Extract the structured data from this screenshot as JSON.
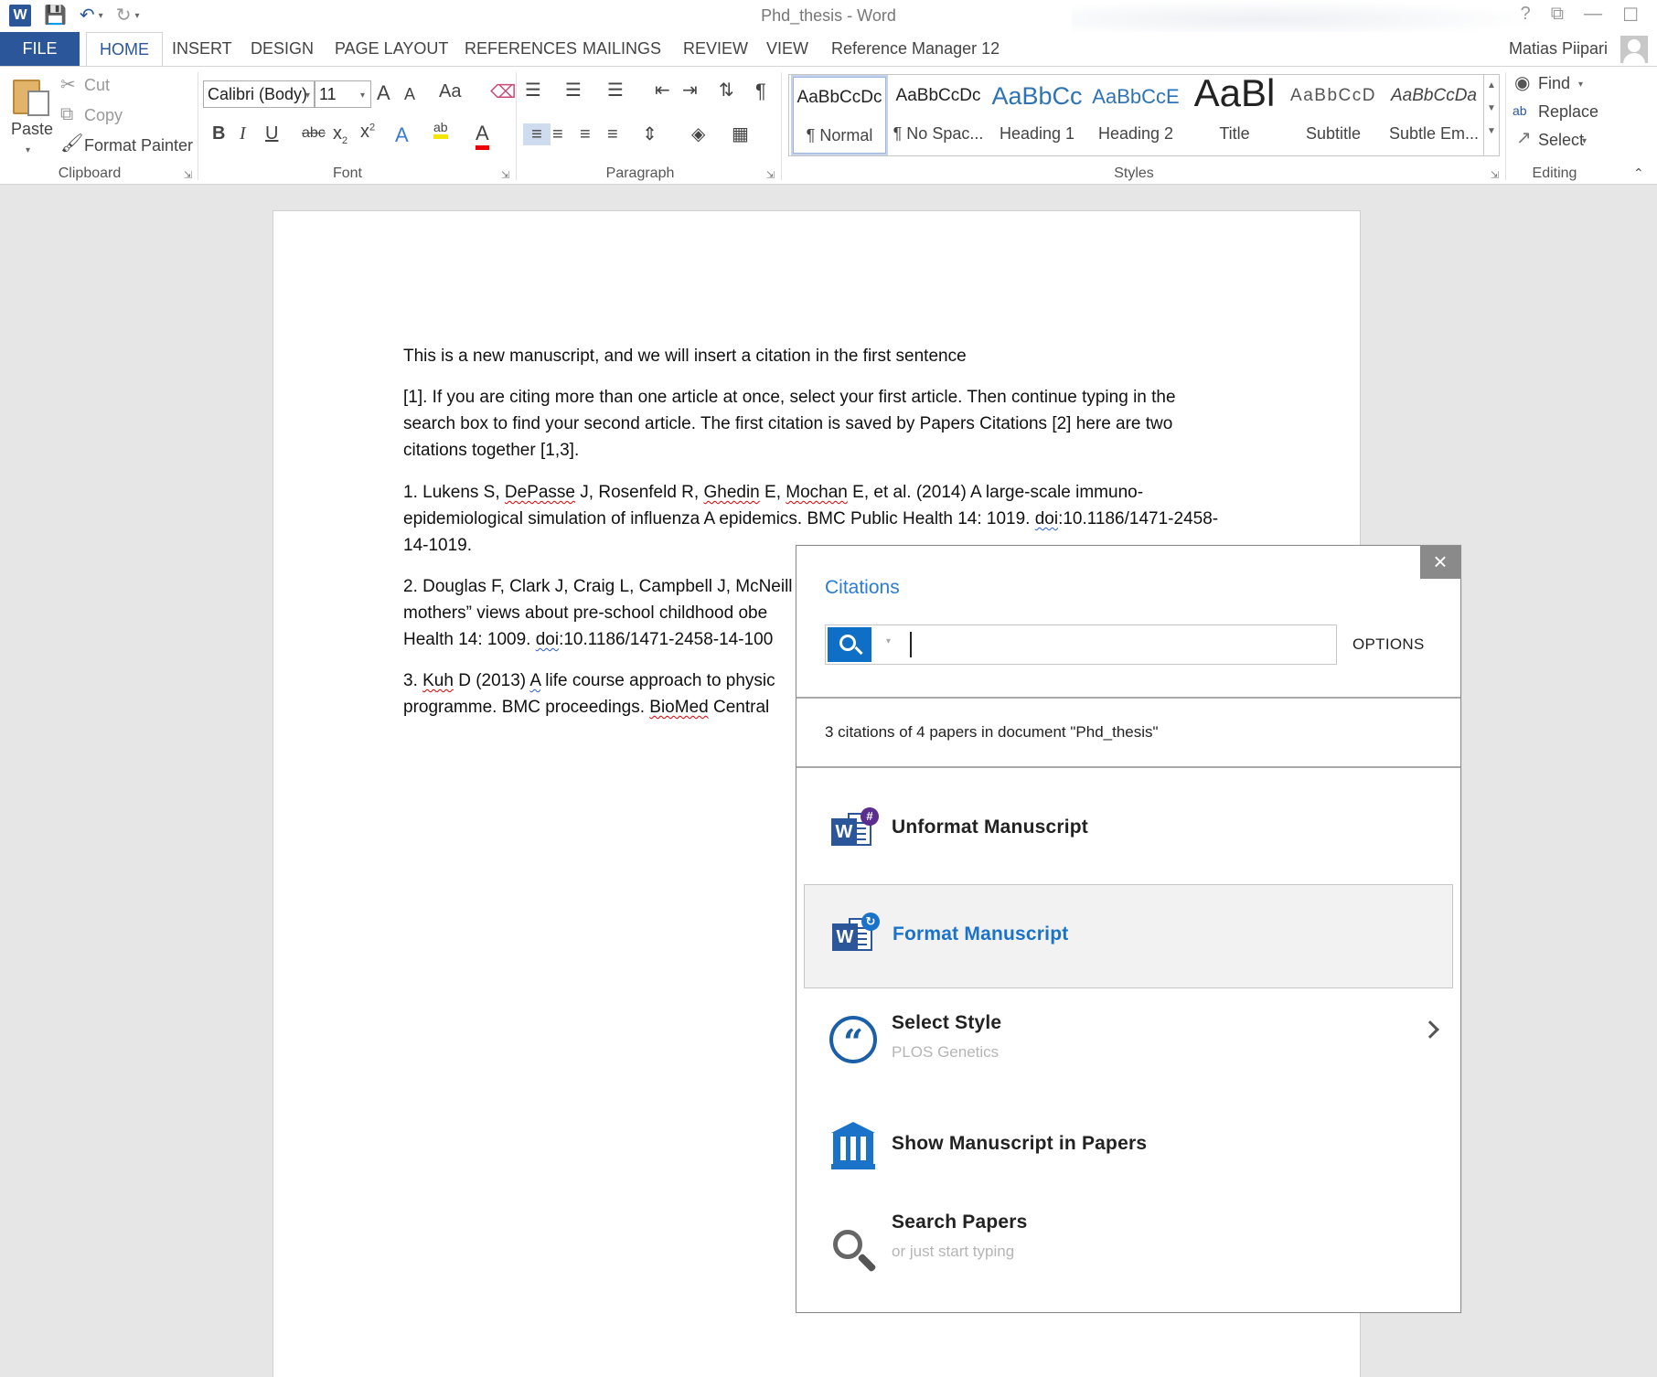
{
  "window": {
    "title": "Phd_thesis - Word",
    "user": "Matias Piipari",
    "controls": [
      "?",
      "⧉",
      "—",
      "☐"
    ]
  },
  "qat": {
    "app_icon": "word-app-icon",
    "save_icon": "floppy-save-icon",
    "undo_icon": "undo-icon",
    "redo_icon": "redo-icon",
    "customize_icon": "qat-customize-icon"
  },
  "tabs": [
    {
      "label": "FILE"
    },
    {
      "label": "HOME"
    },
    {
      "label": "INSERT"
    },
    {
      "label": "DESIGN"
    },
    {
      "label": "PAGE LAYOUT"
    },
    {
      "label": "REFERENCES"
    },
    {
      "label": "MAILINGS"
    },
    {
      "label": "REVIEW"
    },
    {
      "label": "VIEW"
    },
    {
      "label": "Reference Manager 12"
    }
  ],
  "ribbon": {
    "clipboard": {
      "label": "Clipboard",
      "paste": "Paste",
      "cut": "Cut",
      "copy": "Copy",
      "format_painter": "Format Painter"
    },
    "font": {
      "label": "Font",
      "font_name": "Calibri (Body)",
      "font_size": "11",
      "grow": "A",
      "shrink": "A",
      "case": "Aa",
      "bold": "B",
      "italic": "I",
      "underline": "U",
      "strike": "abc",
      "subscript": "x",
      "superscript": "x",
      "text_effects": "A",
      "highlight": "ab",
      "font_color": "A"
    },
    "paragraph": {
      "label": "Paragraph",
      "show_marks": "¶"
    },
    "styles": {
      "label": "Styles",
      "items": [
        {
          "sample": "AaBbCcDc",
          "name": "¶ Normal"
        },
        {
          "sample": "AaBbCcDc",
          "name": "¶ No Spac..."
        },
        {
          "sample": "AaBbCc",
          "name": "Heading 1"
        },
        {
          "sample": "AaBbCcE",
          "name": "Heading 2"
        },
        {
          "sample": "AaBl",
          "name": "Title"
        },
        {
          "sample": "AaBbCcD",
          "name": "Subtitle"
        },
        {
          "sample": "AaBbCcDa",
          "name": "Subtle Em..."
        }
      ]
    },
    "editing": {
      "label": "Editing",
      "find": "Find",
      "replace": "Replace",
      "select": "Select"
    }
  },
  "document": {
    "paragraphs": [
      "This is a new manuscript, and we will insert a citation in the first sentence",
      "[1]. If you are citing more than one article at once, select your first article. Then continue typing in the search box to find your second article. The first citation is saved by Papers Citations [2] here are two citations together [1,3]."
    ],
    "references": {
      "r1_pre": "1. Lukens S, ",
      "r1_a": "DePasse",
      "r1_b": " J, Rosenfeld R, ",
      "r1_c": "Ghedin",
      "r1_d": " E, ",
      "r1_e": "Mochan",
      "r1_f": " E, et al. (2014) A large-scale immuno-epidemiological simulation of influenza A epidemics. BMC Public Health 14: 1019. ",
      "r1_doi": "doi",
      "r1_g": ":10.1186/1471-2458-14-1019.",
      "r2_a": "2. Douglas F, Clark J, Craig L, Campbell J, McNeill",
      "r2_b": "mothers” views about pre-school childhood obe",
      "r2_c": "Health 14: 1009. ",
      "r2_doi": "doi",
      "r2_d": ":10.1186/1471-2458-14-100",
      "r3_a": "3. ",
      "r3_kuh": "Kuh",
      "r3_b": " D (2013) ",
      "r3_A": "A",
      "r3_c": " life course approach to physic",
      "r3_d": "programme. BMC proceedings. ",
      "r3_bio": "BioMed",
      "r3_e": " Central"
    }
  },
  "citations_panel": {
    "title": "Citations",
    "close": "×",
    "search_placeholder": "",
    "options": "OPTIONS",
    "count_text": "3 citations of 4 papers in document \"Phd_thesis\"",
    "actions": [
      {
        "title": "Unformat Manuscript",
        "subtitle": ""
      },
      {
        "title": "Format Manuscript",
        "subtitle": ""
      },
      {
        "title": "Select Style",
        "subtitle": "PLOS Genetics"
      },
      {
        "title": "Show Manuscript in Papers",
        "subtitle": ""
      },
      {
        "title": "Search Papers",
        "subtitle": "or just start typing"
      }
    ]
  },
  "colors": {
    "word_blue": "#2b579a",
    "accent_blue": "#1a73c9",
    "spell_red": "#dd0000"
  }
}
